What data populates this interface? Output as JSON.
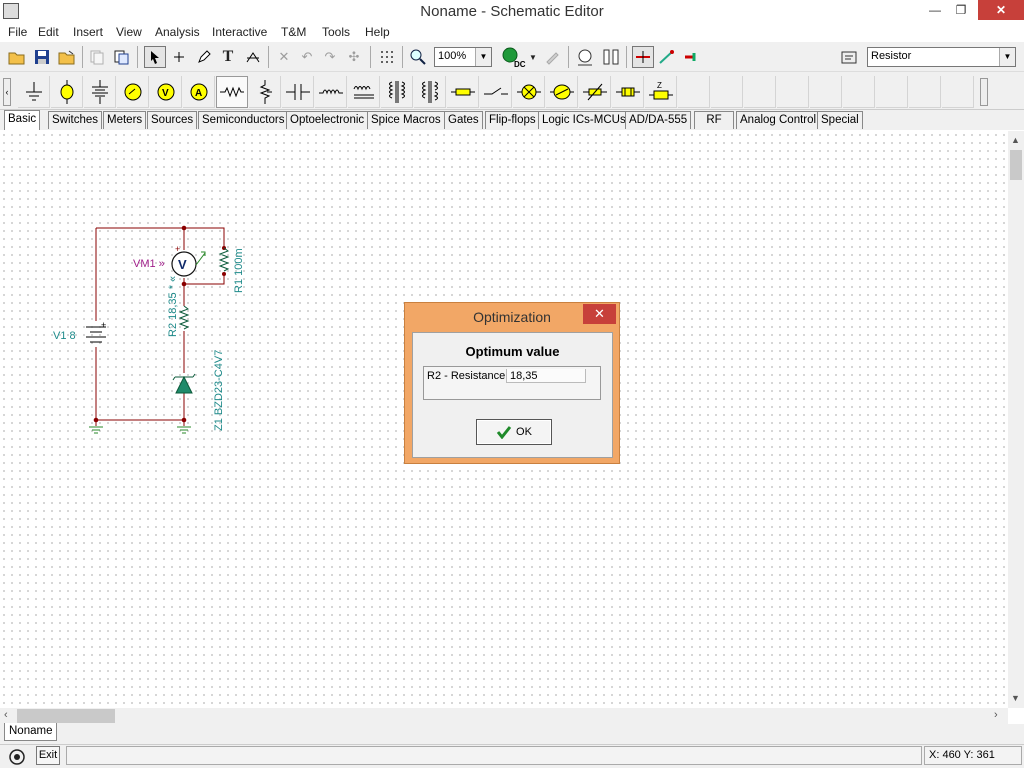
{
  "window": {
    "title": "Noname - Schematic Editor",
    "minimize": "—",
    "restore": "❐",
    "close": "✕"
  },
  "menu": [
    "File",
    "Edit",
    "Insert",
    "View",
    "Analysis",
    "Interactive",
    "T&M",
    "Tools",
    "Help"
  ],
  "toolbar": {
    "zoom": "100%",
    "component": "Resistor",
    "text_tool": "T",
    "dc_label": "DC"
  },
  "palette_tabs": [
    "Basic",
    "Switches",
    "Meters",
    "Sources",
    "Semiconductors",
    "Optoelectronic",
    "Spice Macros",
    "Gates",
    "Flip-flops",
    "Logic ICs-MCUs",
    "AD/DA-555",
    "RF",
    "Analog Control",
    "Special"
  ],
  "palette_tab_selected": "Basic",
  "schematic": {
    "voltmeter_label": "VM1 »",
    "voltmeter_symbol": "V",
    "resistor1_label": "R1 100m",
    "resistor2_label": "R2 18,35 * «",
    "source_label": "V1 8",
    "zener_label": "Z1 BZD23-C4V7",
    "plus": "+"
  },
  "dialog": {
    "title": "Optimization",
    "close": "✕",
    "heading": "Optimum value",
    "result_name": "R2 - Resistance",
    "result_value": "18,35",
    "ok_label": "OK"
  },
  "document_tab": "Noname",
  "status": {
    "exit_label": "Exit",
    "coords": "X: 460  Y: 361"
  },
  "colors": {
    "label_teal": "#1e8a8a",
    "voltmeter_purple": "#a01f8a",
    "dialog_frame": "#f2a766",
    "close_red": "#c7403a"
  }
}
